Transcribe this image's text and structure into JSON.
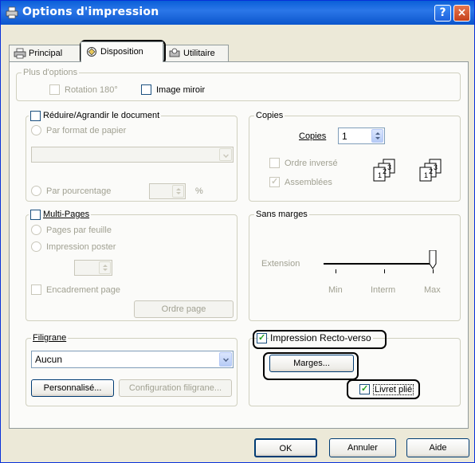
{
  "window": {
    "title": "Options d'impression",
    "help_icon": "?",
    "close_icon": "×"
  },
  "tabs": [
    {
      "label": "Principal",
      "icon": "printer-icon"
    },
    {
      "label": "Disposition",
      "icon": "layout-icon"
    },
    {
      "label": "Utilitaire",
      "icon": "utility-icon"
    }
  ],
  "plus_options": {
    "title": "Plus d'options",
    "rotation": {
      "label": "Rotation 180°",
      "checked": false,
      "enabled": false
    },
    "mirror": {
      "label": "Image miroir",
      "checked": false,
      "enabled": true
    }
  },
  "reduce": {
    "title": "Réduire/Agrandir le document",
    "checked": false,
    "by_paper": "Par format de papier",
    "paper_select_value": "",
    "by_percent": "Par pourcentage",
    "percent_value": "",
    "percent_unit": "%"
  },
  "copies": {
    "title": "Copies",
    "label": "Copies",
    "value": "1",
    "reverse_order": {
      "label": "Ordre inversé",
      "checked": false
    },
    "collate": {
      "label": "Assemblées",
      "checked": true
    },
    "collate_icon_digits": [
      "1",
      "2",
      "3"
    ]
  },
  "multipages": {
    "title": "Multi-Pages",
    "checked": false,
    "pages_per_sheet": "Pages par feuille",
    "poster": "Impression poster",
    "poster_value": "",
    "frame": {
      "label": "Encadrement page",
      "checked": false
    },
    "page_order_button": "Ordre page"
  },
  "borderless": {
    "title": "Sans marges",
    "extension_label": "Extension",
    "levels": [
      "Min",
      "Interm",
      "Max"
    ],
    "selected_level": "Max"
  },
  "watermark": {
    "title": "Filigrane",
    "selected": "Aucun",
    "custom_button": "Personnalisé...",
    "config_button": "Configuration filigrane..."
  },
  "duplex": {
    "label": "Impression Recto-verso",
    "checked": true,
    "margins_button": "Marges...",
    "folded_booklet": {
      "label": "Livret plié",
      "checked": true
    }
  },
  "footer": {
    "ok": "OK",
    "cancel": "Annuler",
    "help": "Aide"
  }
}
